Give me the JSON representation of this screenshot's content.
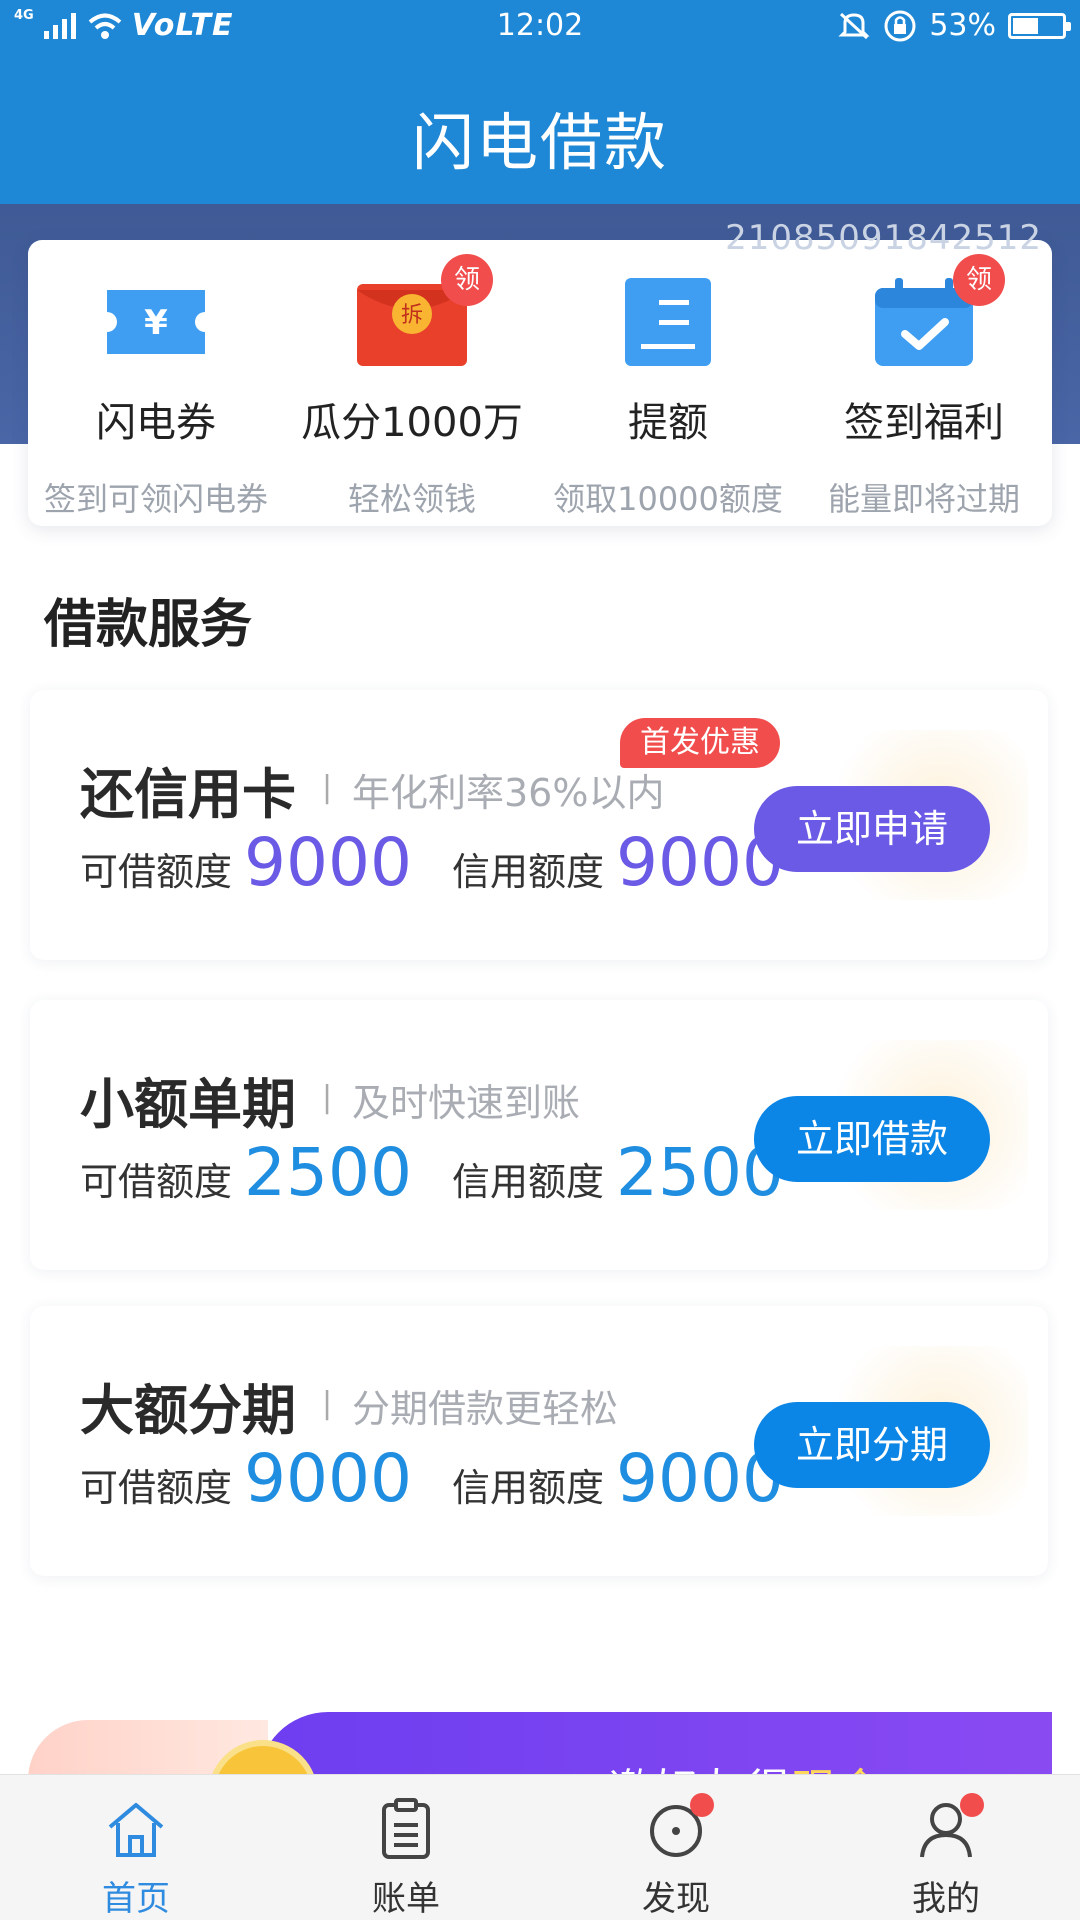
{
  "status_bar": {
    "network": "4G",
    "volte": "VoLTE",
    "time": "12:02",
    "battery_percent": "53%",
    "battery_level": 0.53
  },
  "app_title": "闪电借款",
  "watermark": "21085091842512",
  "features": [
    {
      "icon": "voucher-icon",
      "label": "闪电券",
      "sub": "签到可领闪电券",
      "badge": ""
    },
    {
      "icon": "red-envelope-icon",
      "label": "瓜分1000万",
      "sub": "轻松领钱",
      "badge": "领",
      "envelope_text": "拆"
    },
    {
      "icon": "limit-up-icon",
      "label": "提额",
      "sub": "领取10000额度",
      "badge": ""
    },
    {
      "icon": "calendar-check-icon",
      "label": "签到福利",
      "sub": "能量即将过期",
      "badge": "领"
    }
  ],
  "section_title": "借款服务",
  "loans": [
    {
      "name": "还信用卡",
      "desc": "年化利率36%以内",
      "avail_label": "可借额度",
      "avail_value": "9000",
      "credit_label": "信用额度",
      "credit_value": "9000",
      "button": "立即申请",
      "promo": "首发优惠",
      "accent": "#6a5ae6",
      "button_color": "#6a5ae6"
    },
    {
      "name": "小额单期",
      "desc": "及时快速到账",
      "avail_label": "可借额度",
      "avail_value": "2500",
      "credit_label": "信用额度",
      "credit_value": "2500",
      "button": "立即借款",
      "accent": "#1f8de0",
      "button_color": "#0c86e6"
    },
    {
      "name": "大额分期",
      "desc": "分期借款更轻松",
      "avail_label": "可借额度",
      "avail_value": "9000",
      "credit_label": "信用额度",
      "credit_value": "9000",
      "button": "立即分期",
      "accent": "#1f8de0",
      "button_color": "#0c86e6"
    }
  ],
  "banner": {
    "text_a": "邀好友得",
    "text_b": "现金"
  },
  "tabs": [
    {
      "label": "首页",
      "icon": "home-icon",
      "active": true,
      "dot": false
    },
    {
      "label": "账单",
      "icon": "bill-icon",
      "active": false,
      "dot": false
    },
    {
      "label": "发现",
      "icon": "compass-icon",
      "active": false,
      "dot": true
    },
    {
      "label": "我的",
      "icon": "profile-icon",
      "active": false,
      "dot": true
    }
  ],
  "colors": {
    "primary": "#1e88d6",
    "badge_red": "#f24d4d",
    "purple": "#6a5ae6"
  }
}
